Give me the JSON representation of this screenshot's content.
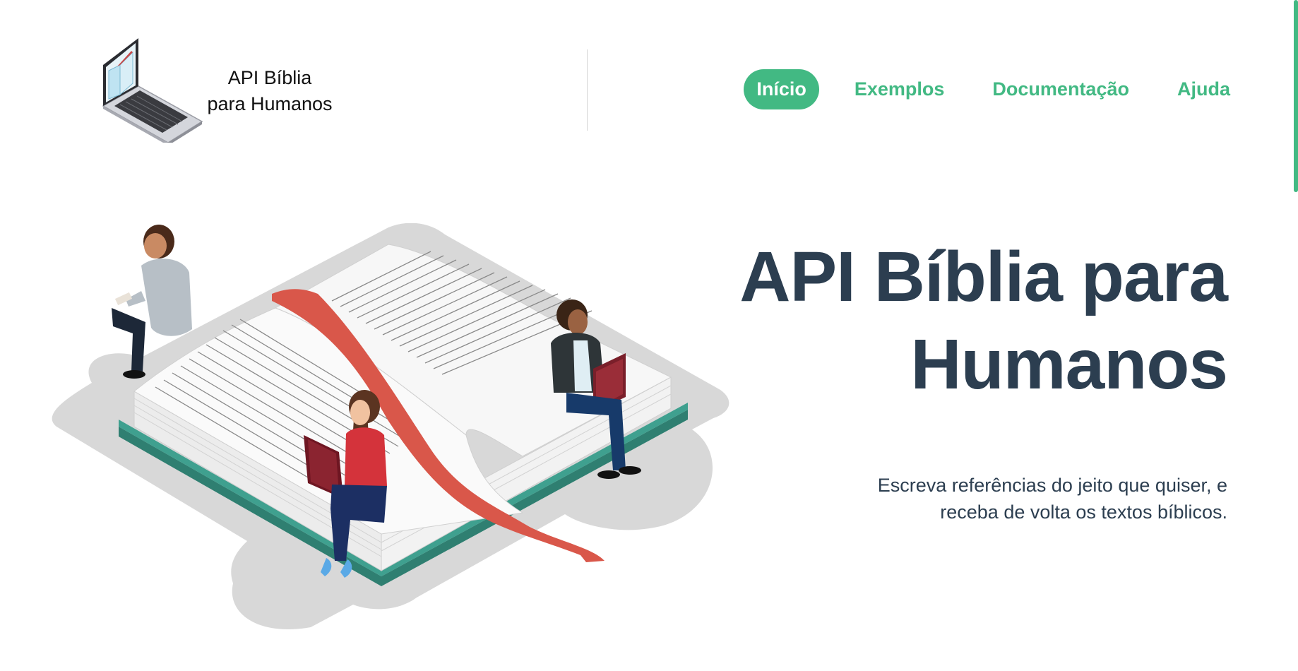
{
  "header": {
    "logo_text": "API Bíblia para Humanos",
    "logo_icon": "laptop-book-icon",
    "nav": [
      {
        "label": "Início",
        "active": true
      },
      {
        "label": "Exemplos",
        "active": false
      },
      {
        "label": "Documentação",
        "active": false
      },
      {
        "label": "Ajuda",
        "active": false
      }
    ]
  },
  "hero": {
    "title": "API Bíblia para Humanos",
    "subtitle": "Escreva referências do jeito que quiser, e receba de volta os textos bíblicos.",
    "illustration": "people-reading-on-giant-bible"
  },
  "colors": {
    "accent": "#42b983",
    "text_dark": "#2c3e50",
    "ribbon": "#d9574a",
    "book_cover": "#3a8f80"
  }
}
